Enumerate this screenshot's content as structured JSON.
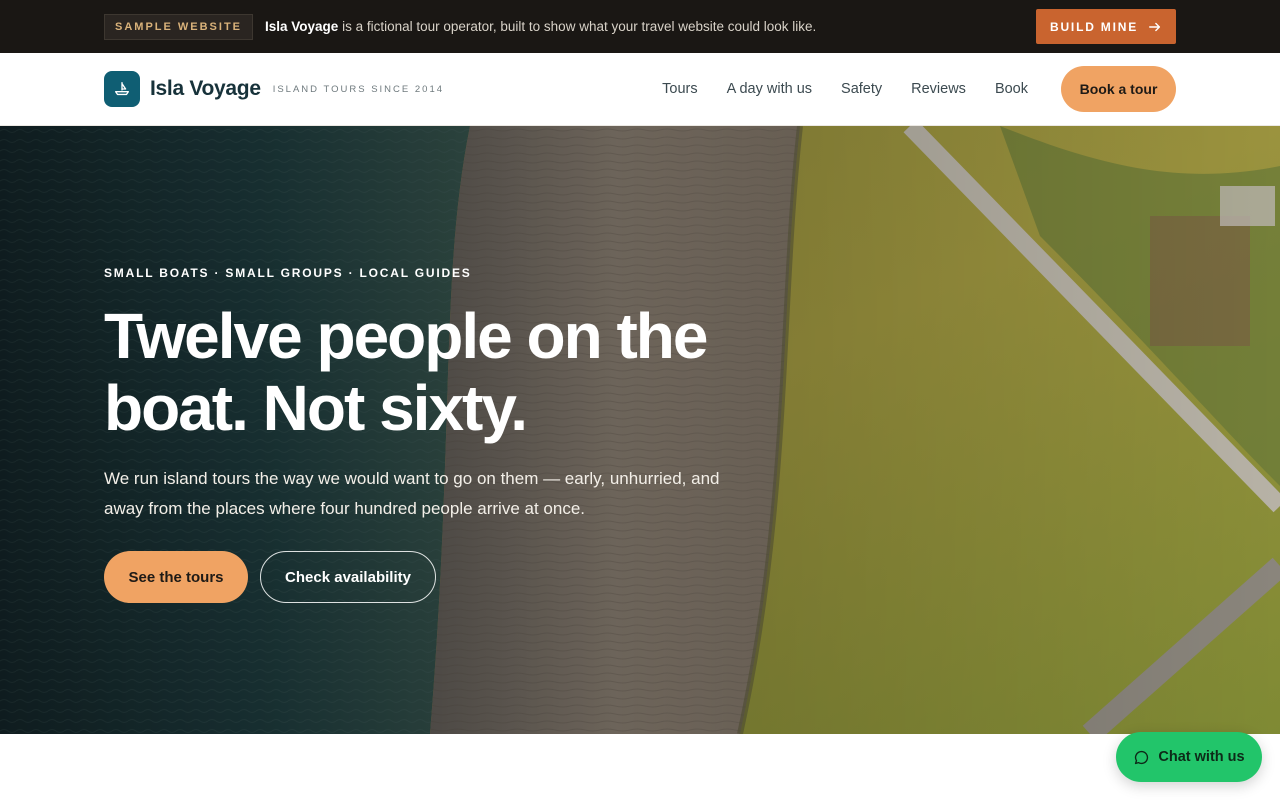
{
  "topbar": {
    "tag": "SAMPLE WEBSITE",
    "brand": "Isla Voyage",
    "message": " is a fictional tour operator, built to show what your travel website could look like.",
    "build_label": "BUILD MINE",
    "build_icon": "arrow-right-icon"
  },
  "header": {
    "logo_icon": "boat-icon",
    "brand": "Isla Voyage",
    "tagline": "ISLAND TOURS SINCE 2014",
    "nav": [
      "Tours",
      "A day with us",
      "Safety",
      "Reviews",
      "Book"
    ],
    "book_label": "Book a tour"
  },
  "hero": {
    "eyebrow": "SMALL BOATS · SMALL GROUPS · LOCAL GUIDES",
    "headline": "Twelve people on the boat. Not sixty.",
    "subtitle": "We run island tours the way we would want to go on them — early, unhurried, and away from the places where four hundred people arrive at once.",
    "cta_primary": "See the tours",
    "cta_secondary": "Check availability",
    "background": "aerial coastline photo"
  },
  "chat": {
    "label": "Chat with us",
    "icon": "chat-bubble-icon"
  },
  "colors": {
    "accent_orange": "#f0a363",
    "build_orange": "#c9642f",
    "logo_teal": "#0f5e73",
    "chat_green": "#22c56a",
    "topbar_dark": "#1a1714"
  }
}
